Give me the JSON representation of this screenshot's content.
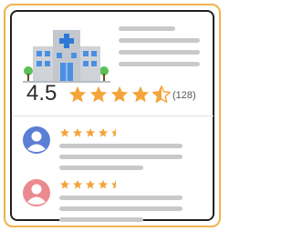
{
  "business": {
    "icon": "hospital-icon",
    "rating": "4.5",
    "rating_value": 4.5,
    "rating_max": 5,
    "review_count": "(128)"
  },
  "reviews": [
    {
      "avatar": "user-avatar-blue",
      "avatar_color": "#5b7fd4",
      "stars": 4.5
    },
    {
      "avatar": "user-avatar-red",
      "avatar_color": "#ea8a8f",
      "stars": 4.5
    }
  ],
  "colors": {
    "star": "#f4a43a",
    "frame": "#f2b24c",
    "border": "#1f1f1f",
    "placeholder_line": "#c9c9c9"
  }
}
